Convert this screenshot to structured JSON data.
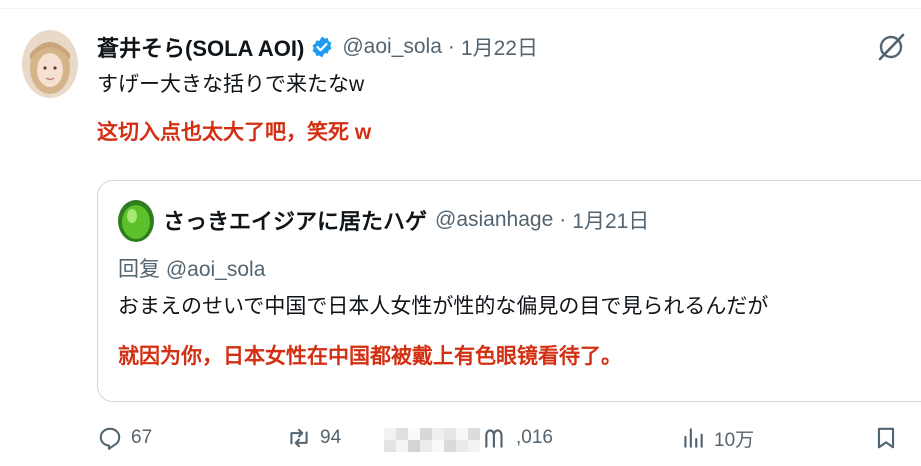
{
  "tweet": {
    "display_name": "蒼井そら(SOLA AOI)",
    "handle": "@aoi_sola",
    "separator": "·",
    "date": "1月22日",
    "text": "すげー大きな括りで来たなw",
    "translation": "这切入点也太大了吧，笑死 w"
  },
  "quote": {
    "display_name": "さっきエイジアに居たハゲ",
    "handle": "@asianhage",
    "separator": "·",
    "date": "1月21日",
    "reply_to": "回复 @aoi_sola",
    "text": "おまえのせいで中国で日本人女性が性的な偏見の目で見られるんだが",
    "translation": "就因为你，日本女性在中国都被戴上有色眼镜看待了。"
  },
  "actions": {
    "replies": "67",
    "retweets": "94",
    "likes": ",016",
    "views": "10万"
  },
  "icons": [
    "verified-badge-icon",
    "grok-icon",
    "reply-icon",
    "retweet-icon",
    "like-icon",
    "views-icon",
    "bookmark-icon"
  ],
  "colors": {
    "verified_blue": "#1d9bf0",
    "translation_red": "#d32f12",
    "secondary_text": "#536471",
    "border": "#cfd9de"
  }
}
